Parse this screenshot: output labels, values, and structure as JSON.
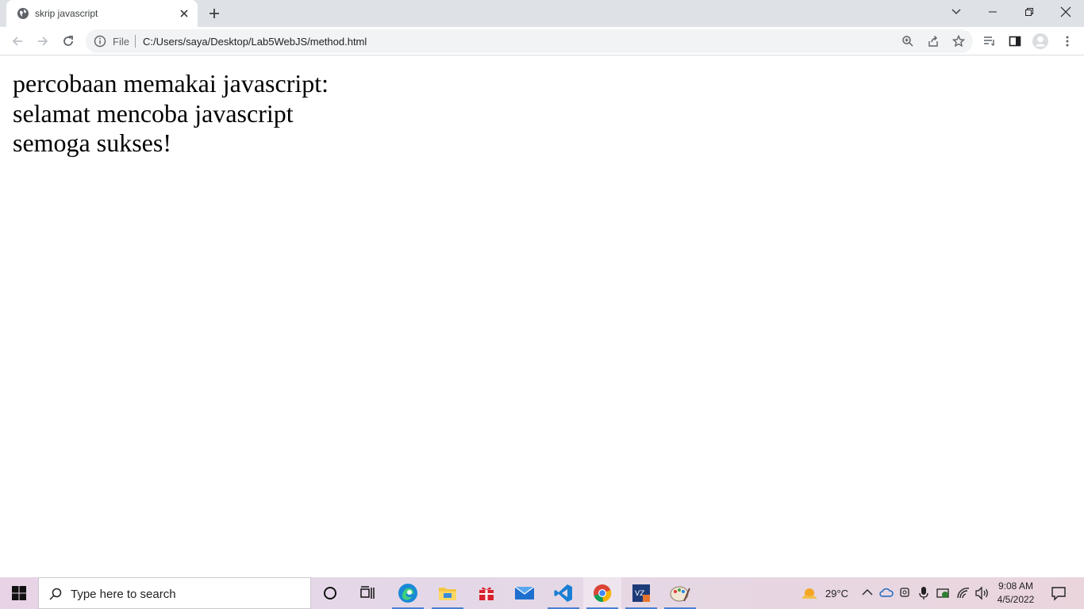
{
  "browser": {
    "tab": {
      "title": "skrip javascript"
    },
    "omnibox": {
      "scheme": "File",
      "url": "C:/Users/saya/Desktop/Lab5WebJS/method.html"
    }
  },
  "page": {
    "lines": [
      "percobaan memakai javascript:",
      "selamat mencoba javascript",
      "semoga sukses!"
    ]
  },
  "taskbar": {
    "search_placeholder": "Type here to search",
    "weather": "29°C",
    "time": "9:08 AM",
    "date": "4/5/2022",
    "apps": [
      "cortana-icon",
      "task-view-icon",
      "edge-icon",
      "file-explorer-icon",
      "gift-app-icon",
      "mail-icon",
      "vscode-icon",
      "chrome-icon",
      "virtualbox-icon",
      "paint-icon"
    ]
  },
  "colors": {
    "accent": "#1a73e8",
    "tabstrip": "#dee1e6",
    "omnibox": "#f1f3f4"
  }
}
